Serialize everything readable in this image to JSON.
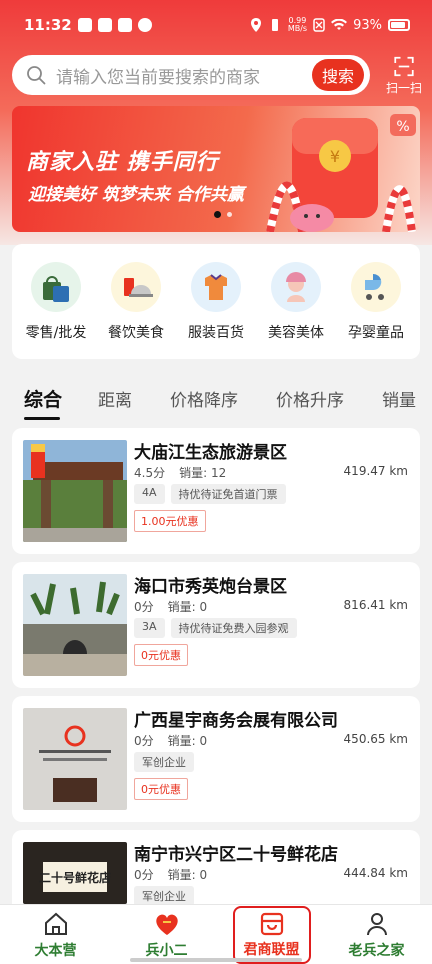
{
  "status_bar": {
    "time": "11:32",
    "net_speed_top": "0.99",
    "net_speed_bottom": "MB/s",
    "battery": "93%"
  },
  "search": {
    "placeholder": "请输入您当前要搜索的商家",
    "button": "搜索",
    "scan_label": "扫一扫"
  },
  "banner": {
    "title": "商家入驻 携手同行",
    "subtitle": "迎接美好 筑梦未来 合作共赢"
  },
  "categories": [
    {
      "label": "零售/批发",
      "icon": "retail-bag-icon",
      "color": "#e6f4ea"
    },
    {
      "label": "餐饮美食",
      "icon": "food-cloche-icon",
      "color": "#fdf6dc"
    },
    {
      "label": "服装百货",
      "icon": "clothes-icon",
      "color": "#e4f1fb"
    },
    {
      "label": "美容美体",
      "icon": "beauty-woman-icon",
      "color": "#e4f1fb"
    },
    {
      "label": "孕婴童品",
      "icon": "stroller-icon",
      "color": "#fdf6dc"
    }
  ],
  "sort_tabs": [
    {
      "label": "综合",
      "active": true
    },
    {
      "label": "距离",
      "active": false
    },
    {
      "label": "价格降序",
      "active": false
    },
    {
      "label": "价格升序",
      "active": false
    },
    {
      "label": "销量",
      "active": false
    }
  ],
  "merchants": [
    {
      "name": "大庙江生态旅游景区",
      "rating": "4.5分",
      "sales": "销量: 12",
      "distance": "419.47 km",
      "tags": [
        "4A",
        "持优待证免首道门票"
      ],
      "coupon": "1.00元优惠",
      "thumb": "scenic-gate"
    },
    {
      "name": "海口市秀英炮台景区",
      "rating": "0分",
      "sales": "销量: 0",
      "distance": "816.41 km",
      "tags": [
        "3A",
        "持优待证免费入园参观"
      ],
      "coupon": "0元优惠",
      "thumb": "fort"
    },
    {
      "name": "广西星宇商务会展有限公司",
      "rating": "0分",
      "sales": "销量: 0",
      "distance": "450.65 km",
      "tags": [
        "军创企业"
      ],
      "coupon": "0元优惠",
      "thumb": "office"
    },
    {
      "name": "南宁市兴宁区二十号鲜花店",
      "rating": "0分",
      "sales": "销量: 0",
      "distance": "444.84 km",
      "tags": [
        "军创企业"
      ],
      "coupon": "",
      "thumb": "flower-shop"
    }
  ],
  "thumb_text": {
    "flower_shop_sign": "二十号鲜花店"
  },
  "bottom_nav": [
    {
      "label": "大本营",
      "icon": "home-icon",
      "active": false
    },
    {
      "label": "兵小二",
      "icon": "heart-logo-icon",
      "active": false
    },
    {
      "label": "君商联盟",
      "icon": "store-icon",
      "active": true
    },
    {
      "label": "老兵之家",
      "icon": "person-icon",
      "active": false
    }
  ],
  "colors": {
    "brand_red": "#e8321f",
    "nav_green": "#2e7d32"
  }
}
